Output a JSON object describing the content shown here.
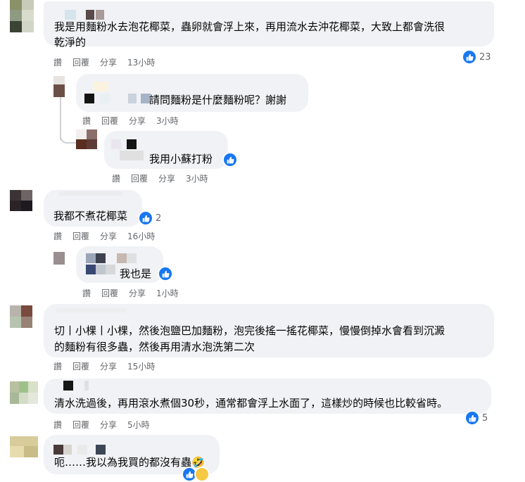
{
  "actions": {
    "read": "讚",
    "reply": "回覆",
    "share": "分享"
  },
  "colors": {
    "bubble": "#f0f2f5",
    "meta": "#65676b",
    "like": "#1877f2",
    "thread": "#ced0d4"
  },
  "comments": [
    {
      "text_line1": "我是用麵粉水去泡花椰菜，蟲卵就會浮上來，再用流水去沖花椰菜，大致上都會洗很",
      "text_line2": "乾淨的",
      "time": "13小時",
      "reactions": "23"
    },
    {
      "text": "請問麵粉是什麼麵粉呢？謝謝",
      "time": "3小時"
    },
    {
      "text": "我用小蘇打粉",
      "time": "3小時"
    },
    {
      "text": "我都不煮花椰菜",
      "time": "16小時",
      "reactions": "2"
    },
    {
      "text": "我也是",
      "time": "1小時"
    },
    {
      "text_line1": "切丨小棵丨小棵，然後泡鹽巴加麵粉，泡完後搖一搖花椰菜，慢慢倒掉水會看到沉澱",
      "text_line2": "的麵粉有很多蟲，然後再用清水泡洗第二次",
      "time": "15小時"
    },
    {
      "text": "清水洗過後，再用滾水煮個30秒，通常都會浮上水面了，這樣炒的時候也比較省時。",
      "time": "5小時",
      "reactions": "5"
    },
    {
      "text": "呃……我以為我買的都沒有蟲🤣"
    }
  ]
}
